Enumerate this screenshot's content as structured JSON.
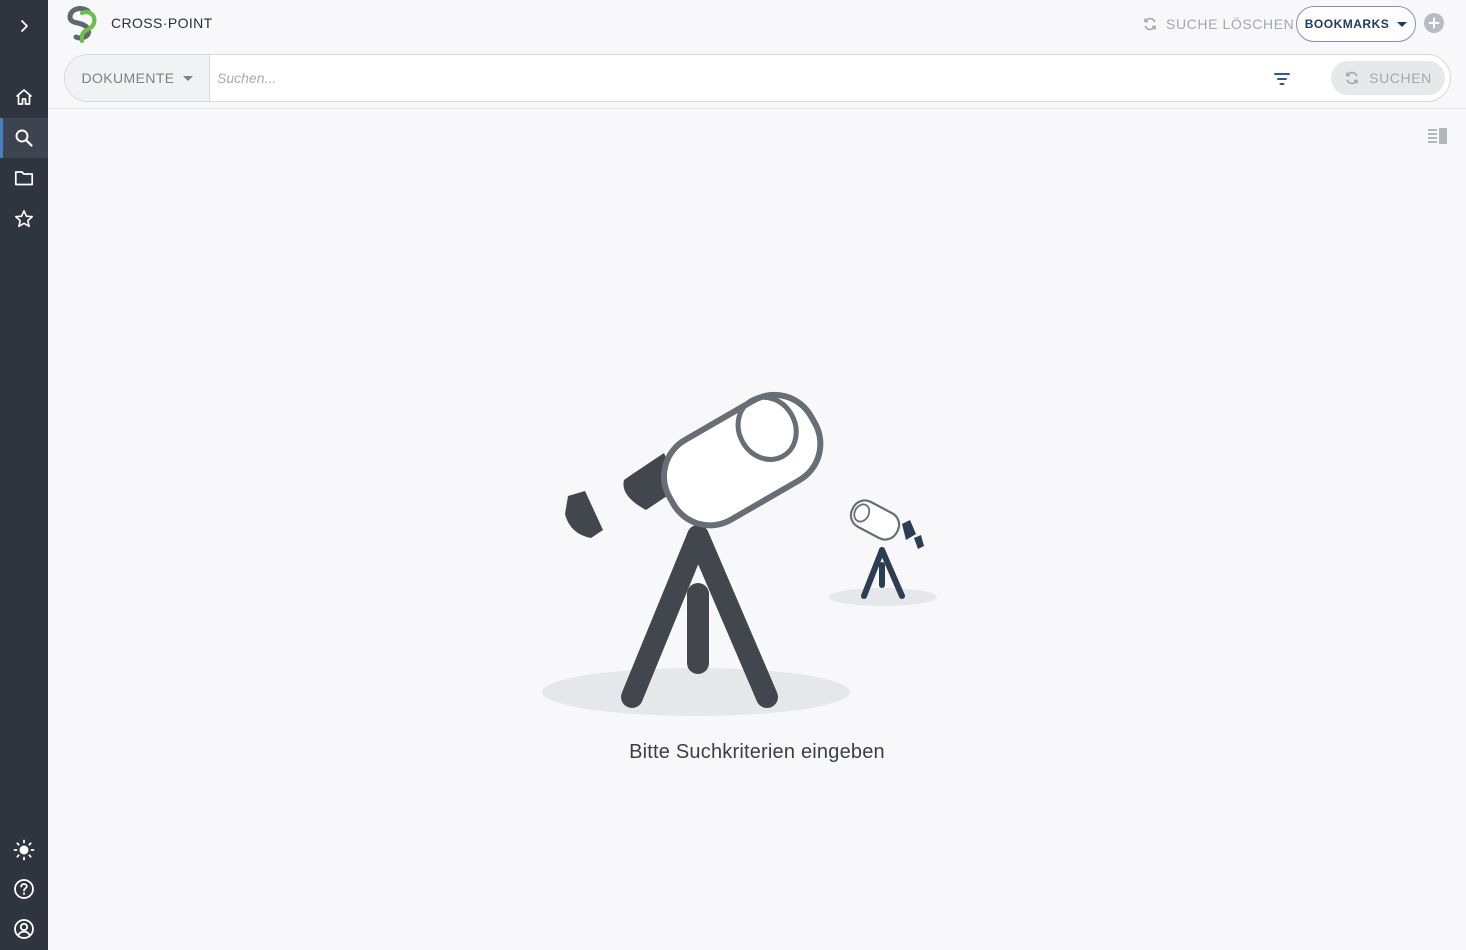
{
  "header": {
    "app_title": "CROSS·POINT",
    "clear_search_label": "SUCHE LÖSCHEN",
    "bookmarks_label": "BOOKMARKS"
  },
  "search": {
    "scope_label": "DOKUMENTE",
    "placeholder": "Suchen...",
    "value": "",
    "submit_label": "SUCHEN"
  },
  "sidebar": {
    "active_item": "search",
    "items": [
      "expand",
      "home",
      "search",
      "folder",
      "favorites"
    ],
    "bottom_items": [
      "theme",
      "help",
      "account"
    ]
  },
  "empty_state": {
    "message": "Bitte Suchkriterien eingeben"
  },
  "colors": {
    "sidebar_bg": "#2f353e",
    "accent": "#4a7fc1",
    "brand_green": "#6cc04a",
    "brand_gray": "#5f6770",
    "illustration_dark": "#42474d",
    "illustration_navy": "#2d3e52"
  }
}
